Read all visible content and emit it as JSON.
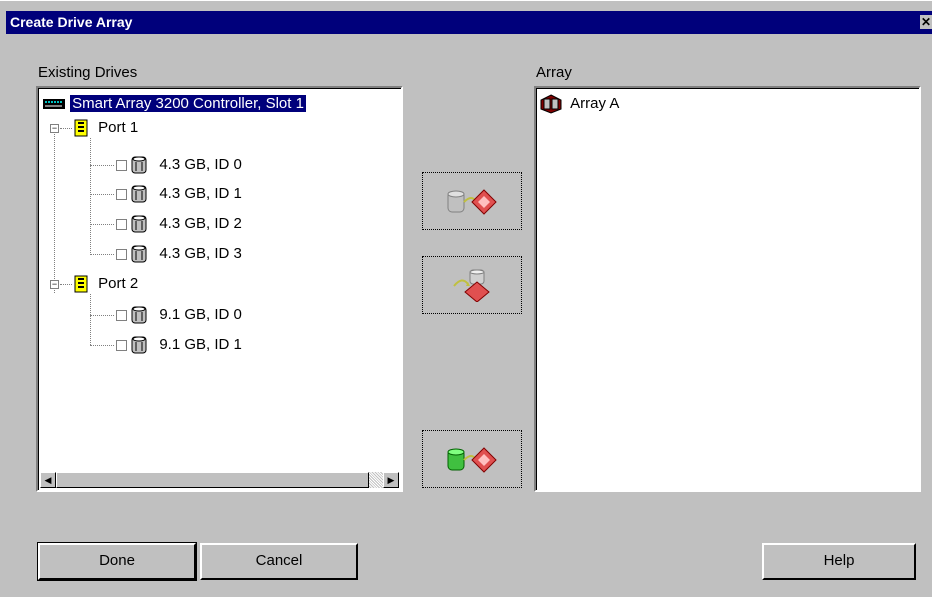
{
  "window": {
    "title": "Create Drive Array",
    "close_glyph": "✕"
  },
  "existing_drives": {
    "label": "Existing Drives",
    "controller": "Smart Array 3200 Controller, Slot 1",
    "ports": [
      {
        "label": "Port 1",
        "drives": [
          "4.3 GB, ID 0",
          "4.3 GB, ID 1",
          "4.3 GB, ID 2",
          "4.3 GB, ID 3"
        ]
      },
      {
        "label": "Port 2",
        "drives": [
          "9.1 GB, ID 0",
          "9.1 GB, ID 1"
        ]
      }
    ]
  },
  "array_panel": {
    "label": "Array",
    "items": [
      "Array A"
    ]
  },
  "actions": {
    "add_drive_icon": "add-drive-to-array-icon",
    "remove_drive_icon": "remove-drive-from-array-icon",
    "add_spare_icon": "assign-spare-drive-icon"
  },
  "buttons": {
    "done": "Done",
    "cancel": "Cancel",
    "help": "Help"
  },
  "colors": {
    "selection": "#00007b",
    "titlebar": "#00007b",
    "face": "#c0c0c0"
  }
}
